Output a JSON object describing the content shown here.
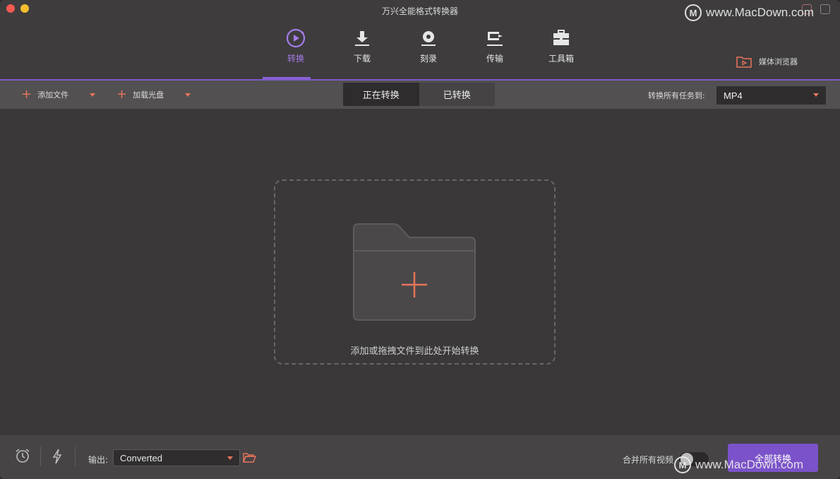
{
  "window": {
    "title": "万兴全能格式转换器"
  },
  "watermark": {
    "text": "www.MacDown.com",
    "logo_letter": "M"
  },
  "nav": {
    "items": [
      {
        "label": "转换",
        "icon": "convert-play-icon",
        "active": true
      },
      {
        "label": "下载",
        "icon": "download-icon",
        "active": false
      },
      {
        "label": "刻录",
        "icon": "burn-disc-icon",
        "active": false
      },
      {
        "label": "传输",
        "icon": "transfer-icon",
        "active": false
      },
      {
        "label": "工具箱",
        "icon": "toolbox-icon",
        "active": false
      }
    ],
    "media_browser_label": "媒体浏览器"
  },
  "toolbar": {
    "add_files_label": "添加文件",
    "load_disc_label": "加载光盘",
    "tabs": [
      {
        "label": "正在转换",
        "selected": true
      },
      {
        "label": "已转换",
        "selected": false
      }
    ],
    "convert_all_to_label": "转换所有任务到:",
    "format_value": "MP4"
  },
  "main": {
    "drop_hint": "添加或拖拽文件到此处开始转换"
  },
  "bottom": {
    "output_label": "输出:",
    "output_value": "Converted",
    "merge_label": "合并所有视频",
    "merge_enabled": false,
    "convert_all_button": "全部转换"
  },
  "colors": {
    "accent_purple": "#7b52c9",
    "accent_orange": "#e8745b",
    "background": "#3a3839"
  }
}
